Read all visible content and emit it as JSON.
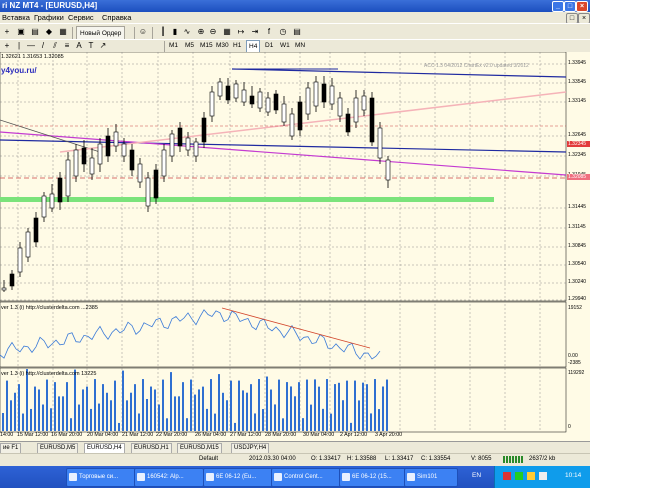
{
  "window": {
    "title": "ri NZ MT4 - [EURUSD,H4]"
  },
  "menu": [
    "Вставка",
    "Графики",
    "Сервис",
    "Справка"
  ],
  "toolbar": {
    "new_order": "Новый Ордер"
  },
  "timeframes": [
    "M1",
    "M5",
    "M15",
    "M30",
    "H1",
    "H4",
    "D1",
    "W1",
    "MN"
  ],
  "timeframe_active": "H4",
  "chart": {
    "ohlc": "1.32621 1.31653 1.32085",
    "watermark": "y4you.ru/",
    "top_right_info": "ACC 1.3 04/2012 ChartEx v2.0 updated 3/2012",
    "price_axis": [
      "1.33945",
      "1.33545",
      "1.33145",
      "1.32645",
      "1.32345",
      "1.31945",
      "1.31445",
      "1.31145",
      "1.30845",
      "1.30540",
      "1.30240",
      "1.29940"
    ],
    "current_price_1": "1.32345",
    "current_price_2": "1.32085",
    "indicator1": {
      "label": "ver 1.3 (i) http://clusterdelta.com ...2385",
      "scale_top": "19152",
      "scale_mid": "0.00",
      "scale_bottom": "-2385"
    },
    "indicator2": {
      "label": "ver 1.3 (i) http://clusterdelta.com 13225",
      "scale_top": "119292",
      "scale_bottom": "0"
    },
    "dates": [
      "14:00",
      "15 Mar 12:00",
      "16 Mar 20:00",
      "20 Mar 04:00",
      "21 Mar 12:00",
      "22 Mar 20:00",
      "26 Mar 04:00",
      "27 Mar 12:00",
      "28 Mar 20:00",
      "30 Mar 04:00",
      "2 Apr 12:00",
      "3 Apr 20:00"
    ]
  },
  "tabs": [
    "ие F1",
    "EURUSD,M5",
    "EURUSD,H4",
    "EURUSD,H1",
    "EURUSD,M15",
    "USDJPY,H4"
  ],
  "tab_active": "EURUSD,H4",
  "status": {
    "profile": "Default",
    "datetime": "2012.03.30 04:00",
    "open": "O: 1.33417",
    "high": "H: 1.33588",
    "low": "L: 1.33417",
    "close": "C: 1.33554",
    "volume": "V: 8055",
    "traffic": "2637/2 kb"
  },
  "taskbar": {
    "buttons": [
      "Торговые си...",
      "160542: Alp...",
      "6E 06-12 (Eu...",
      "Control Cent...",
      "6E 06-12 (15...",
      "Sim101"
    ],
    "lang": "EN",
    "clock": "10:14"
  }
}
